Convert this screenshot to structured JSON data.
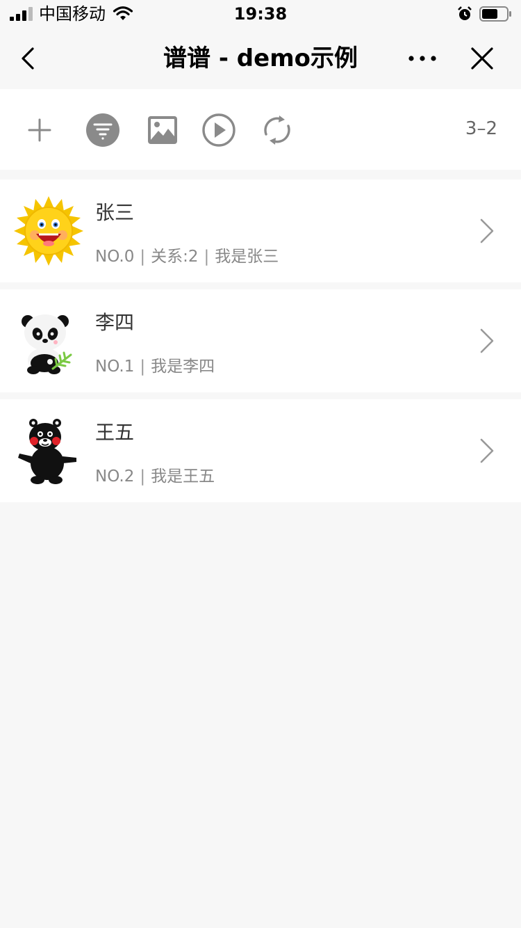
{
  "status_bar": {
    "carrier": "中国移动",
    "time": "19:38"
  },
  "nav": {
    "title": "谱谱 - demo示例"
  },
  "toolbar": {
    "buttons": [
      {
        "icon": "plus-icon"
      },
      {
        "icon": "filter-icon"
      },
      {
        "icon": "image-icon"
      },
      {
        "icon": "play-icon"
      },
      {
        "icon": "refresh-icon"
      }
    ],
    "count": "3–2"
  },
  "list": {
    "items": [
      {
        "name": "张三",
        "no": "NO.0",
        "relation": "关系:2",
        "intro": "我是张三",
        "avatar": "sun-avatar"
      },
      {
        "name": "李四",
        "no": "NO.1",
        "intro": "我是李四",
        "avatar": "panda-avatar"
      },
      {
        "name": "王五",
        "no": "NO.2",
        "intro": "我是王五",
        "avatar": "bear-avatar"
      }
    ]
  },
  "colors": {
    "background": "#f7f7f7",
    "card": "#ffffff",
    "icon_gray": "#8a8a8a"
  }
}
